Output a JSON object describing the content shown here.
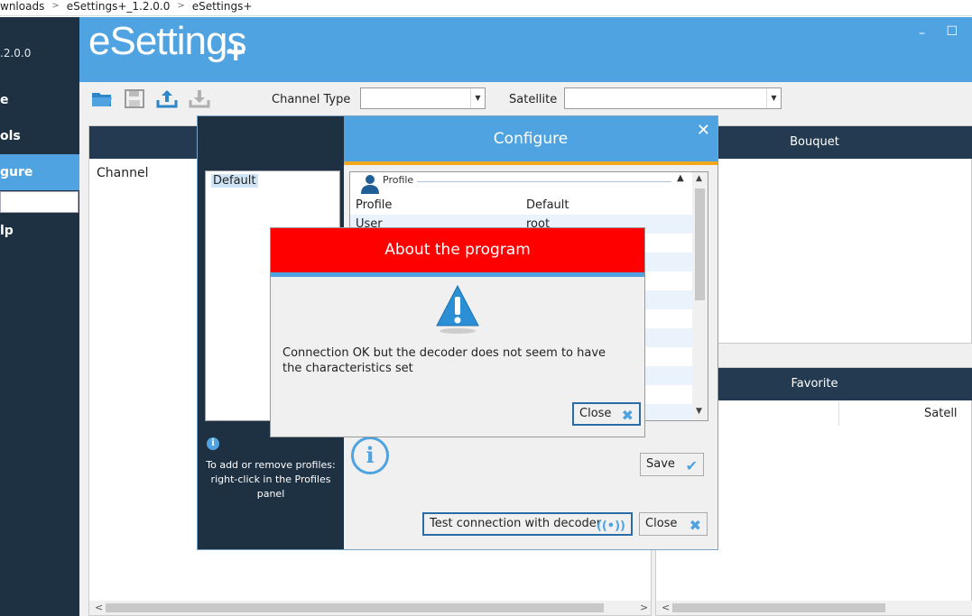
{
  "address": {
    "parts": [
      "wnloads",
      "eSettings+_1.2.0.0",
      "eSettings+"
    ]
  },
  "sidebar": {
    "version": ".2.0.0",
    "items": [
      {
        "label": "e"
      },
      {
        "label": "ols"
      },
      {
        "label": "gure"
      },
      {
        "label": "lp"
      }
    ]
  },
  "header": {
    "logo_text": "eSettings",
    "logo_plus": "+",
    "minimize": "–",
    "maximize": "☐"
  },
  "toolbar": {
    "channel_type_label": "Channel Type",
    "channel_type_value": "",
    "satellite_label": "Satellite",
    "satellite_value": ""
  },
  "panels": {
    "channel_label": "Channel",
    "bouquet_label": "Bouquet",
    "favorite_label": "Favorite",
    "satellite_col": "Satell"
  },
  "configure": {
    "title": "Configure",
    "close_symbol": "✕",
    "profiles": [
      "Default"
    ],
    "hint": "To add or remove profiles: right-click in the Profiles panel",
    "info_symbol": "i",
    "section_title": "Profile",
    "rows": [
      {
        "key": "Profile",
        "value": "Default"
      },
      {
        "key": "User",
        "value": "root"
      }
    ],
    "save_label": "Save",
    "test_label": "Test connection with decoder",
    "close_label": "Close"
  },
  "about": {
    "title": "About the program",
    "message": "Connection OK but the decoder does not seem to have the characteristics set",
    "close_label": "Close"
  },
  "colors": {
    "accent": "#4fa3e0",
    "dark": "#1e3142",
    "header_dark": "#233a50",
    "alert_red": "#ff0000",
    "band_orange": "#f2a81d"
  }
}
